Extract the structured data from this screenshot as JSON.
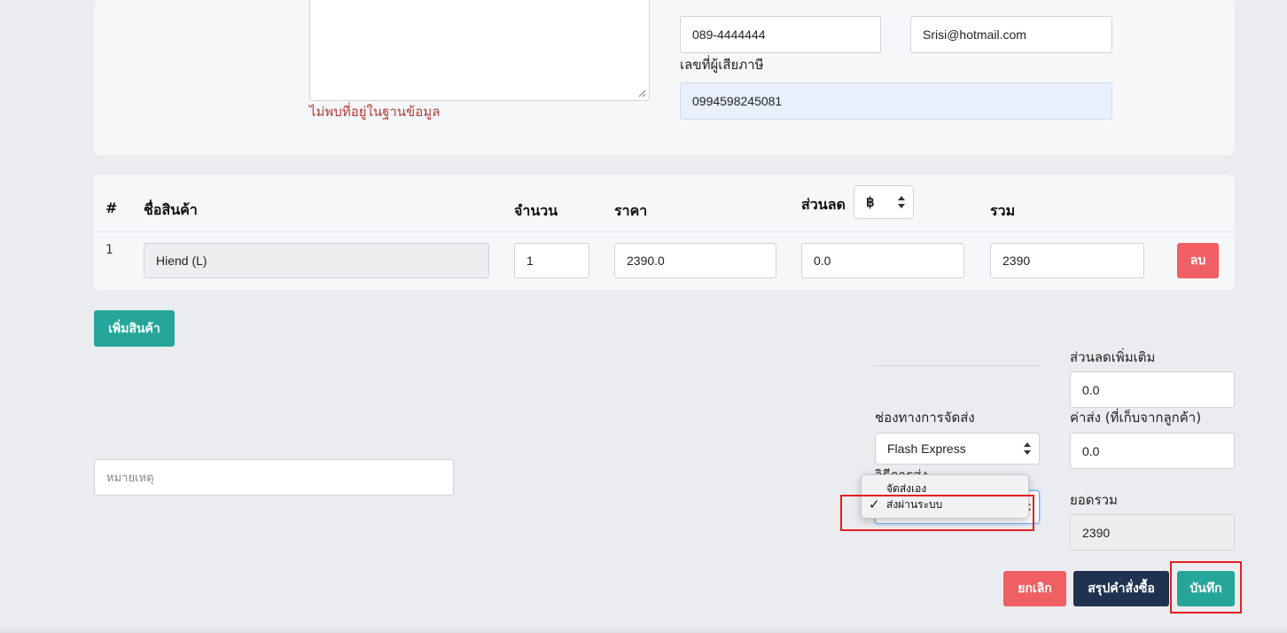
{
  "customer": {
    "phone_value": "089-4444444",
    "email_value": "Srisi@hotmail.com",
    "tax_id_label": "เลขที่ผู้เสียภาษี",
    "tax_id_value": "0994598245081",
    "address_error": "ไม่พบที่อยู่ในฐานข้อมูล"
  },
  "items_table": {
    "headers": {
      "index": "#",
      "product": "ชื่อสินค้า",
      "qty": "จำนวน",
      "price": "ราคา",
      "discount": "ส่วนลด",
      "total": "รวม"
    },
    "discount_unit": "฿",
    "rows": [
      {
        "index": "1",
        "product": "Hiend (L)",
        "qty": "1",
        "price": "2390.0",
        "discount": "0.0",
        "total": "2390",
        "delete_label": "ลบ"
      }
    ]
  },
  "add_product_label": "เพิ่มสินค้า",
  "note": {
    "placeholder": "หมายเหตุ"
  },
  "shipping": {
    "channel_label": "ช่องทางการจัดส่ง",
    "channel_value": "Flash Express",
    "method_label": "วิธีการส่ง",
    "method_options": [
      "จัดส่งเอง",
      "ส่งผ่านระบบ"
    ],
    "check_mark": "✓"
  },
  "summary": {
    "extra_discount_label": "ส่วนลดเพิ่มเติม",
    "extra_discount_value": "0.0",
    "shipping_fee_label": "ค่าส่ง (ที่เก็บจากลูกค้า)",
    "shipping_fee_value": "0.0",
    "grand_total_label": "ยอดรวม",
    "grand_total_value": "2390"
  },
  "actions": {
    "cancel": "ยกเลิก",
    "summary": "สรุปคำสั่งซื้อ",
    "save": "บันทึก"
  },
  "colors": {
    "primary": "#26a69a",
    "danger": "#ef5f63",
    "dark": "#1f3350",
    "error_text": "#b43c3c"
  }
}
